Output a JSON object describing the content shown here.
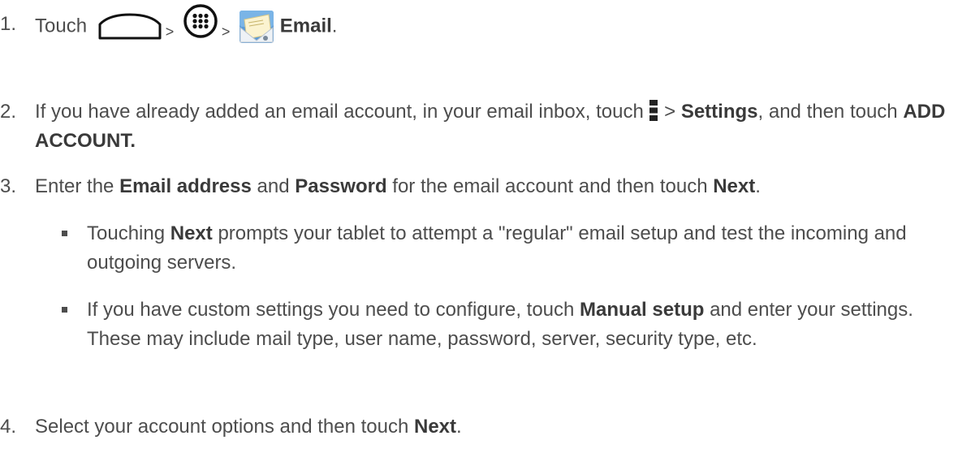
{
  "steps": [
    {
      "number": "1.",
      "prefix": "Touch",
      "sep1": ">",
      "sep2": ">",
      "app_label": "Email",
      "end": ".",
      "icons": [
        "home-icon",
        "apps-icon",
        "email-app-icon"
      ]
    },
    {
      "number": "2.",
      "t1": "If you have already added an email account, in your email inbox, touch",
      "sep": ">",
      "b1": "Settings",
      "t2": ", and then touch",
      "b2": "ADD ACCOUNT.",
      "icons": [
        "menu-icon"
      ]
    },
    {
      "number": "3.",
      "t1": "Enter the",
      "b1": "Email address",
      "t2": "and",
      "b2": "Password",
      "t3": "for the email account and then touch",
      "b3": "Next",
      "t4": "."
    },
    {
      "number": "4.",
      "t1": "Select your account options and then touch",
      "b1": "Next",
      "t2": "."
    }
  ],
  "bullets": [
    {
      "t1": "Touching",
      "b1": "Next",
      "t2": "prompts your tablet to attempt a \"regular\" email setup and test the incoming and outgoing servers."
    },
    {
      "t1": "If you have custom settings you need to configure, touch",
      "b1": "Manual setup",
      "t2": "and enter your settings. These may include mail type, user name, password, server, security type, etc."
    }
  ],
  "colors": {
    "text": "#4d4d4d",
    "email_icon_blue": "#4a90d9",
    "email_icon_envelope": "#f5e6a8"
  }
}
